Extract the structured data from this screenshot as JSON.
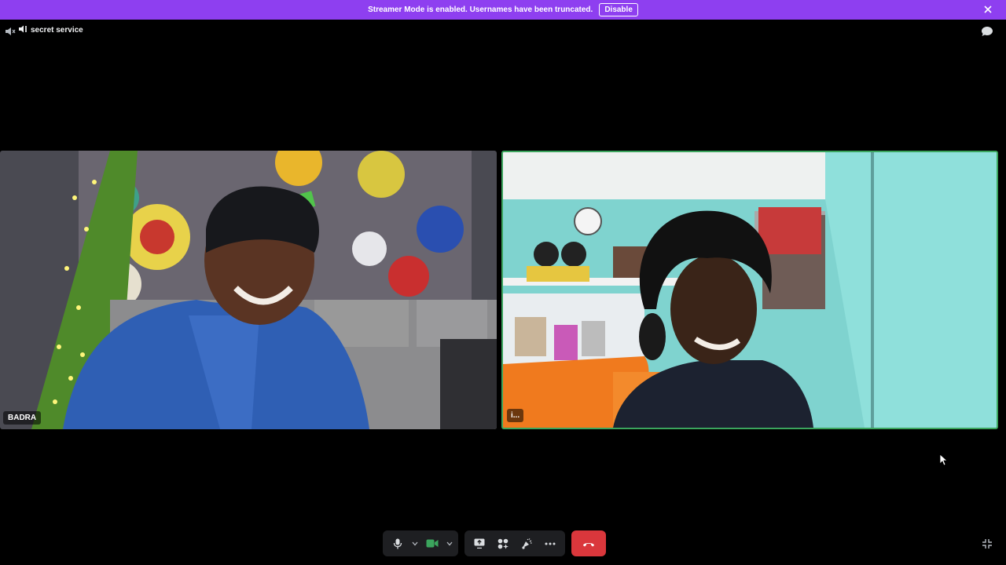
{
  "banner": {
    "message": "Streamer Mode is enabled. Usernames have been truncated.",
    "disable_label": "Disable",
    "color": "#8e3ff0"
  },
  "channel": {
    "name": "secret service",
    "icon": "speaker-icon"
  },
  "participants": [
    {
      "name": "BADRA",
      "speaking": false
    },
    {
      "name": "i...",
      "speaking": true,
      "speaking_color": "#3ba55d"
    }
  ],
  "controls": {
    "icons": [
      "microphone-icon",
      "chevron-down-icon",
      "camera-icon",
      "chevron-down-icon",
      "screen-share-icon",
      "activity-icon",
      "soundboard-icon",
      "more-icon",
      "hang-up-icon"
    ],
    "hangup_color": "#da373c",
    "camera_color": "#3ba55d"
  }
}
